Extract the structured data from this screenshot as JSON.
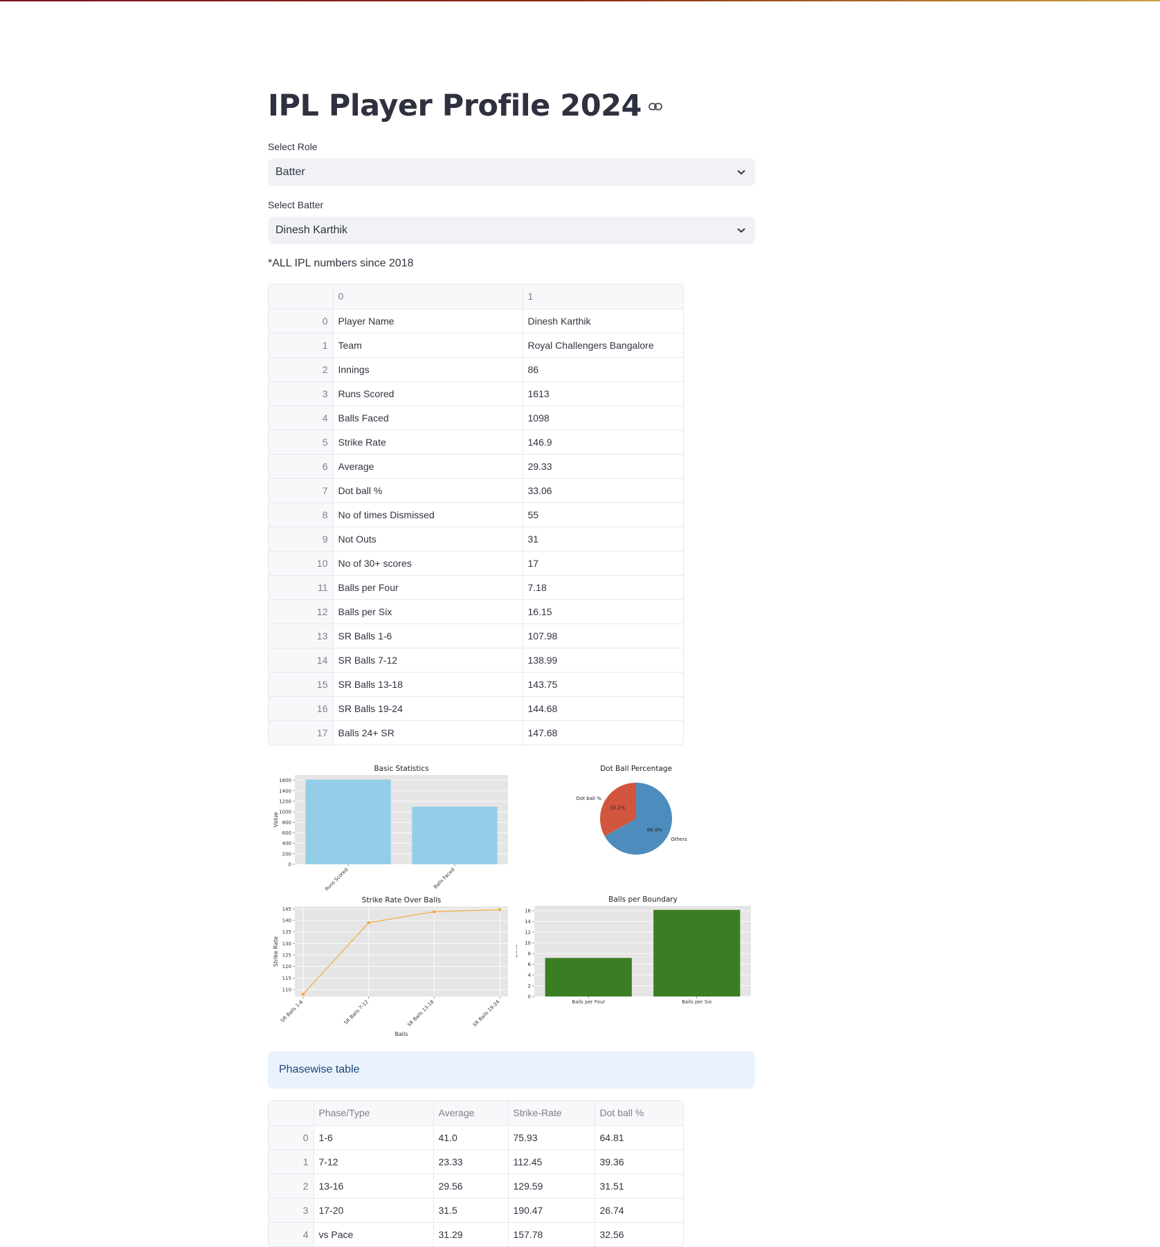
{
  "page": {
    "title": "IPL Player Profile 2024",
    "link_icon": "link-icon",
    "role_label": "Select Role",
    "role_value": "Batter",
    "batter_label": "Select Batter",
    "batter_value": "Dinesh Karthik",
    "note": "*ALL IPL numbers since 2018",
    "phasewise_label": "Phasewise table"
  },
  "profile_table": {
    "columns": [
      "",
      "0",
      "1"
    ],
    "rows": [
      {
        "idx": "0",
        "key": "Player Name",
        "value": "Dinesh Karthik"
      },
      {
        "idx": "1",
        "key": "Team",
        "value": "Royal Challengers Bangalore"
      },
      {
        "idx": "2",
        "key": "Innings",
        "value": "86"
      },
      {
        "idx": "3",
        "key": "Runs Scored",
        "value": "1613"
      },
      {
        "idx": "4",
        "key": "Balls Faced",
        "value": "1098"
      },
      {
        "idx": "5",
        "key": "Strike Rate",
        "value": "146.9"
      },
      {
        "idx": "6",
        "key": "Average",
        "value": "29.33"
      },
      {
        "idx": "7",
        "key": "Dot ball %",
        "value": "33.06"
      },
      {
        "idx": "8",
        "key": "No of times Dismissed",
        "value": "55"
      },
      {
        "idx": "9",
        "key": "Not Outs",
        "value": "31"
      },
      {
        "idx": "10",
        "key": "No of 30+ scores",
        "value": "17"
      },
      {
        "idx": "11",
        "key": "Balls per Four",
        "value": "7.18"
      },
      {
        "idx": "12",
        "key": "Balls per Six",
        "value": "16.15"
      },
      {
        "idx": "13",
        "key": "SR Balls 1-6",
        "value": "107.98"
      },
      {
        "idx": "14",
        "key": "SR Balls 7-12",
        "value": "138.99"
      },
      {
        "idx": "15",
        "key": "SR Balls 13-18",
        "value": "143.75"
      },
      {
        "idx": "16",
        "key": "SR Balls 19-24",
        "value": "144.68"
      },
      {
        "idx": "17",
        "key": "Balls 24+ SR",
        "value": "147.68"
      }
    ]
  },
  "chart_data": [
    {
      "type": "bar",
      "title": "Basic Statistics",
      "xlabel": "",
      "ylabel": "Value",
      "categories": [
        "Runs Scored",
        "Balls Faced"
      ],
      "values": [
        1613,
        1098
      ],
      "ylim": [
        0,
        1700
      ],
      "yticks": [
        0,
        200,
        400,
        600,
        800,
        1000,
        1200,
        1400,
        1600
      ],
      "color": "#93cde8",
      "grid": true
    },
    {
      "type": "pie",
      "title": "Dot Ball Percentage",
      "labels": [
        "Dot ball %",
        "Others"
      ],
      "values": [
        33.1,
        66.9
      ],
      "pct_labels": [
        "33.1%",
        "66.9%"
      ],
      "colors": [
        "#d2553d",
        "#4d8dbd"
      ]
    },
    {
      "type": "line",
      "title": "Strike Rate Over Balls",
      "xlabel": "Balls",
      "ylabel": "Strike Rate",
      "categories": [
        "SR Balls 1-6",
        "SR Balls 7-12",
        "SR Balls 13-18",
        "SR Balls 19-24"
      ],
      "values": [
        107.98,
        138.99,
        143.75,
        144.68
      ],
      "ylim": [
        107,
        146
      ],
      "yticks": [
        110,
        115,
        120,
        125,
        130,
        135,
        140,
        145
      ],
      "color": "#f0ad45",
      "grid": true
    },
    {
      "type": "bar",
      "title": "Balls per Boundary",
      "xlabel": "",
      "ylabel": "Balls",
      "categories": [
        "Balls per Four",
        "Balls per Six"
      ],
      "values": [
        7.18,
        16.15
      ],
      "ylim": [
        0,
        16.9
      ],
      "yticks": [
        0,
        2,
        4,
        6,
        8,
        10,
        12,
        14,
        16
      ],
      "color": "#3a7d22",
      "grid": true
    }
  ],
  "phase_table": {
    "columns": [
      "",
      "Phase/Type",
      "Average",
      "Strike-Rate",
      "Dot ball %"
    ],
    "rows": [
      {
        "idx": "0",
        "phase": "1-6",
        "avg": "41.0",
        "sr": "75.93",
        "dot": "64.81"
      },
      {
        "idx": "1",
        "phase": "7-12",
        "avg": "23.33",
        "sr": "112.45",
        "dot": "39.36"
      },
      {
        "idx": "2",
        "phase": "13-16",
        "avg": "29.56",
        "sr": "129.59",
        "dot": "31.51"
      },
      {
        "idx": "3",
        "phase": "17-20",
        "avg": "31.5",
        "sr": "190.47",
        "dot": "26.74"
      },
      {
        "idx": "4",
        "phase": "vs Pace",
        "avg": "31.29",
        "sr": "157.78",
        "dot": "32.56"
      }
    ]
  }
}
